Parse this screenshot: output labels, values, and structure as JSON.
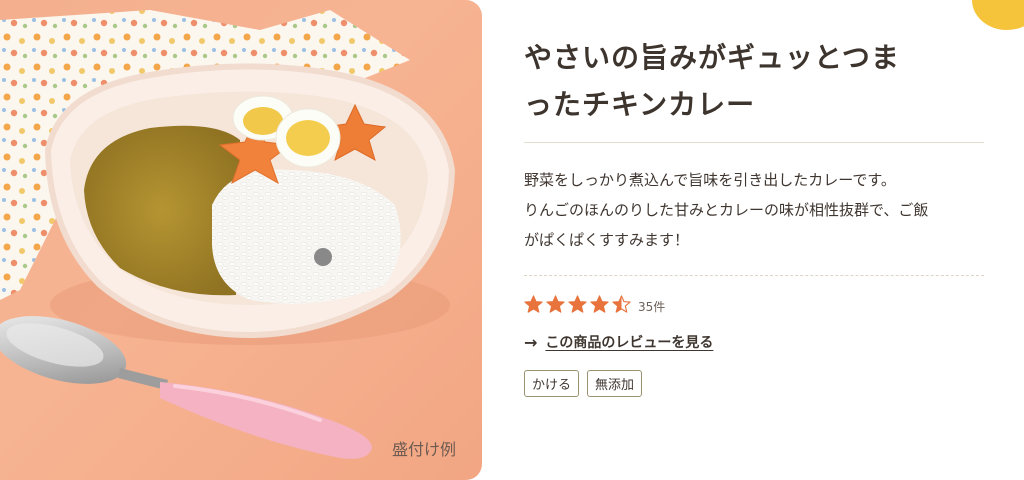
{
  "product": {
    "title_line1": "やさいの旨みがギュッとつま",
    "title_line2": "ったチキンカレー",
    "description_line1": "野菜をしっかり煮込んで旨味を引き出したカレーです。",
    "description_line2": "りんごのほんのりした甘みとカレーの味が相性抜群で、ご飯",
    "description_line3": "がぱくぱくすすみます！"
  },
  "image": {
    "caption": "盛付け例"
  },
  "rating": {
    "value": 4.5,
    "max": 5,
    "count_label": "35件",
    "star_color": "#e8733c"
  },
  "review_link": {
    "label": "この商品のレビューを見る"
  },
  "tags": [
    "かける",
    "無添加"
  ],
  "colors": {
    "accent_yellow": "#f6c43a",
    "photo_background": "#f4b08e"
  }
}
